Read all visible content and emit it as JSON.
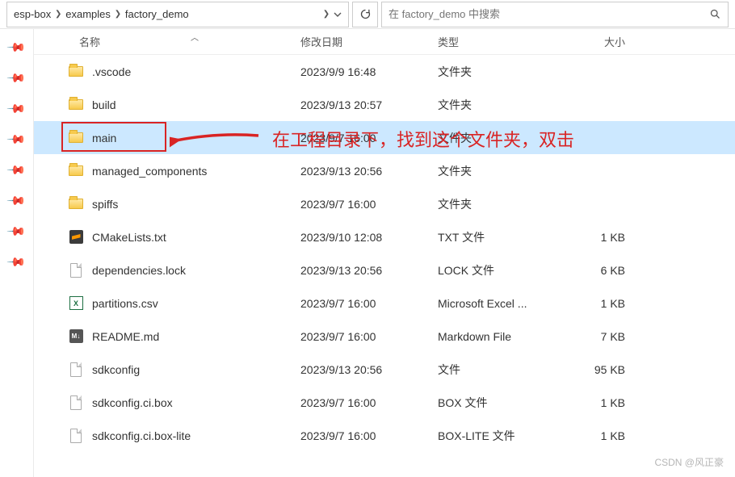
{
  "breadcrumb": {
    "items": [
      "esp-box",
      "examples",
      "factory_demo"
    ]
  },
  "search": {
    "placeholder": "在 factory_demo 中搜索"
  },
  "columns": {
    "name": "名称",
    "date": "修改日期",
    "type": "类型",
    "size": "大小"
  },
  "rows": [
    {
      "icon": "folder",
      "name": ".vscode",
      "date": "2023/9/9 16:48",
      "type": "文件夹",
      "size": ""
    },
    {
      "icon": "folder",
      "name": "build",
      "date": "2023/9/13 20:57",
      "type": "文件夹",
      "size": ""
    },
    {
      "icon": "folder",
      "name": "main",
      "date": "2023/9/7 16:00",
      "type": "文件夹",
      "size": "",
      "selected": true
    },
    {
      "icon": "folder",
      "name": "managed_components",
      "date": "2023/9/13 20:56",
      "type": "文件夹",
      "size": ""
    },
    {
      "icon": "folder",
      "name": "spiffs",
      "date": "2023/9/7 16:00",
      "type": "文件夹",
      "size": ""
    },
    {
      "icon": "sublime",
      "name": "CMakeLists.txt",
      "date": "2023/9/10 12:08",
      "type": "TXT 文件",
      "size": "1 KB"
    },
    {
      "icon": "file",
      "name": "dependencies.lock",
      "date": "2023/9/13 20:56",
      "type": "LOCK 文件",
      "size": "6 KB"
    },
    {
      "icon": "excel",
      "name": "partitions.csv",
      "date": "2023/9/7 16:00",
      "type": "Microsoft Excel ...",
      "size": "1 KB"
    },
    {
      "icon": "md",
      "name": "README.md",
      "date": "2023/9/7 16:00",
      "type": "Markdown File",
      "size": "7 KB"
    },
    {
      "icon": "file",
      "name": "sdkconfig",
      "date": "2023/9/13 20:56",
      "type": "文件",
      "size": "95 KB"
    },
    {
      "icon": "file",
      "name": "sdkconfig.ci.box",
      "date": "2023/9/7 16:00",
      "type": "BOX 文件",
      "size": "1 KB"
    },
    {
      "icon": "file",
      "name": "sdkconfig.ci.box-lite",
      "date": "2023/9/7 16:00",
      "type": "BOX-LITE 文件",
      "size": "1 KB"
    }
  ],
  "annotation": {
    "text": "在工程目录下，找到这个文件夹，双击",
    "color": "#d92424"
  },
  "watermark": "CSDN @风正豪"
}
